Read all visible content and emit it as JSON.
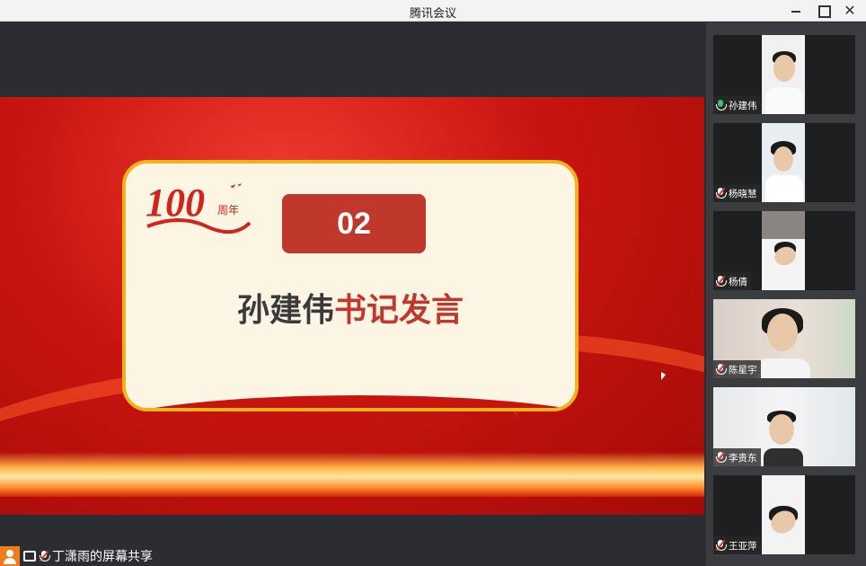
{
  "window": {
    "title": "腾讯会议",
    "min_glyph": "",
    "max_glyph": "",
    "close_glyph": "✕"
  },
  "slide": {
    "badge": "02",
    "heading_name": "孙建伟",
    "heading_rest": "书记发言",
    "logo": {
      "number": "100",
      "suffix": "周年"
    }
  },
  "participants": [
    {
      "name": "孙建伟",
      "mic": "on"
    },
    {
      "name": "杨晓慧",
      "mic": "muted"
    },
    {
      "name": "杨倩",
      "mic": "muted"
    },
    {
      "name": "陈星宇",
      "mic": "muted"
    },
    {
      "name": "李贵东",
      "mic": "muted"
    },
    {
      "name": "王亚萍",
      "mic": "muted"
    }
  ],
  "share": {
    "label": "丁潇雨的屏幕共享"
  },
  "colors": {
    "accent_red": "#c0372b",
    "card_border": "#f2b11d",
    "mic_on": "#35c46a",
    "share_orange": "#ef7d1c"
  }
}
